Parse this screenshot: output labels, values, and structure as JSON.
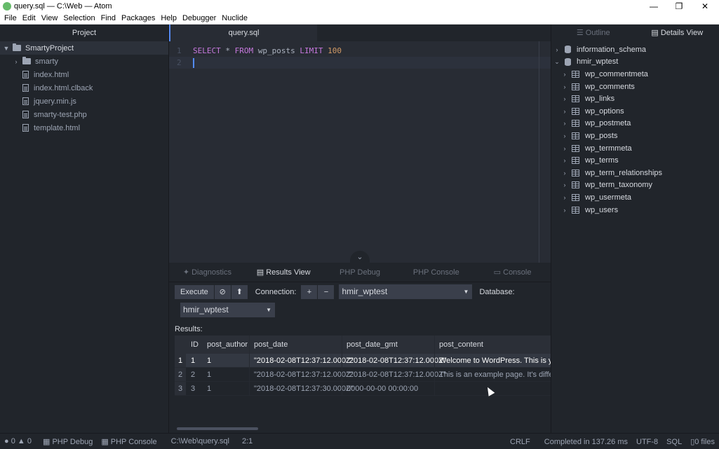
{
  "window": {
    "title": "query.sql — C:\\Web — Atom",
    "minimize": "—",
    "restore": "❐",
    "close": "✕"
  },
  "menu": [
    "File",
    "Edit",
    "View",
    "Selection",
    "Find",
    "Packages",
    "Help",
    "Debugger",
    "Nuclide"
  ],
  "project": {
    "header": "Project",
    "root": "SmartyProject",
    "items": [
      {
        "type": "folder",
        "label": "smarty"
      },
      {
        "type": "file",
        "label": "index.html"
      },
      {
        "type": "file",
        "label": "index.html.clback"
      },
      {
        "type": "file",
        "label": "jquery.min.js"
      },
      {
        "type": "file",
        "label": "smarty-test.php"
      },
      {
        "type": "file",
        "label": "template.html"
      }
    ]
  },
  "editor": {
    "tab": "query.sql",
    "lines": [
      {
        "num": "1",
        "text": "SELECT * FROM wp_posts LIMIT 100"
      },
      {
        "num": "2",
        "text": ""
      }
    ],
    "kw_select": "SELECT",
    "star": " * ",
    "kw_from": "FROM",
    "table": " wp_posts ",
    "kw_limit": "LIMIT",
    "limit_value": "100"
  },
  "dock": {
    "tabs": [
      "Diagnostics",
      "Results View",
      "PHP Debug",
      "PHP Console",
      "Console"
    ],
    "execute": "Execute",
    "connection_label": "Connection:",
    "connection_value": "hmir_wptest",
    "database_label": "Database:",
    "database_value": "hmir_wptest",
    "results_label": "Results:",
    "columns": [
      "ID",
      "post_author",
      "post_date",
      "post_date_gmt",
      "post_content"
    ],
    "rows": [
      {
        "idx": "1",
        "id": "1",
        "author": "1",
        "date": "\"2018-02-08T12:37:12.000Z\"",
        "gmt": "\"2018-02-08T12:37:12.000Z\"",
        "content": "Welcome to WordPress. This is your fi"
      },
      {
        "idx": "2",
        "id": "2",
        "author": "1",
        "date": "\"2018-02-08T12:37:12.000Z\"",
        "gmt": "\"2018-02-08T12:37:12.000Z\"",
        "content": "This is an example page. It's different"
      },
      {
        "idx": "3",
        "id": "3",
        "author": "1",
        "date": "\"2018-02-08T12:37:30.000Z\"",
        "gmt": "0000-00-00 00:00:00",
        "content": ""
      }
    ]
  },
  "details": {
    "tabs": [
      "Outline",
      "Details View"
    ],
    "databases": [
      "information_schema",
      "hmir_wptest"
    ],
    "tables": [
      "wp_commentmeta",
      "wp_comments",
      "wp_links",
      "wp_options",
      "wp_postmeta",
      "wp_posts",
      "wp_termmeta",
      "wp_terms",
      "wp_term_relationships",
      "wp_term_taxonomy",
      "wp_usermeta",
      "wp_users"
    ]
  },
  "status": {
    "errors": "0",
    "warnings": "0",
    "php_debug": "PHP Debug",
    "php_console": "PHP Console",
    "path": "C:\\Web\\query.sql",
    "position": "2:1",
    "line_ending": "CRLF",
    "completed": "Completed in 137.26 ms",
    "encoding": "UTF-8",
    "grammar": "SQL",
    "files": "0 files"
  }
}
